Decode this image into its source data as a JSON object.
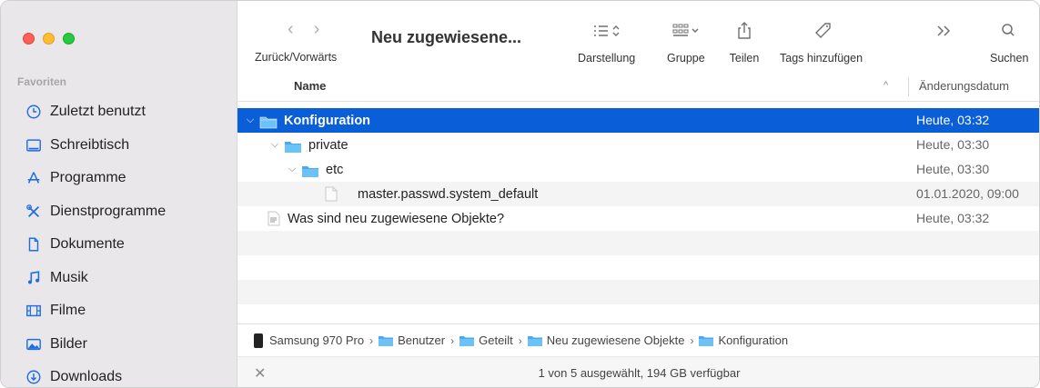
{
  "window": {
    "title": "Neu zugewiesene...",
    "colors": {
      "accent": "#0a5fd8",
      "sidebar_bg": "#e9e7ea",
      "icon_blue": "#1f6fe2"
    }
  },
  "toolbar": {
    "nav_label": "Zurück/Vorwärts",
    "back_icon": "chevron-left-icon",
    "forward_icon": "chevron-right-icon",
    "buttons": [
      {
        "label": "Darstellung",
        "icon": "list-view-icon"
      },
      {
        "label": "Gruppe",
        "icon": "group-grid-icon"
      },
      {
        "label": "Teilen",
        "icon": "share-icon"
      },
      {
        "label": "Tags hinzufügen",
        "icon": "tag-icon"
      },
      {
        "label": "",
        "icon": "overflow-chevrons-icon"
      },
      {
        "label": "Suchen",
        "icon": "search-icon"
      }
    ]
  },
  "sidebar": {
    "section": "Favoriten",
    "items": [
      {
        "label": "Zuletzt benutzt",
        "icon": "clock-icon"
      },
      {
        "label": "Schreibtisch",
        "icon": "desktop-icon"
      },
      {
        "label": "Programme",
        "icon": "apps-icon"
      },
      {
        "label": "Dienstprogramme",
        "icon": "tools-icon"
      },
      {
        "label": "Dokumente",
        "icon": "document-icon"
      },
      {
        "label": "Musik",
        "icon": "music-icon"
      },
      {
        "label": "Filme",
        "icon": "film-icon"
      },
      {
        "label": "Bilder",
        "icon": "photo-icon"
      },
      {
        "label": "Downloads",
        "icon": "download-icon"
      }
    ]
  },
  "columns": {
    "name": "Name",
    "date": "Änderungsdatum",
    "sort_caret": "^"
  },
  "files": [
    {
      "name": "Konfiguration",
      "date": "Heute, 03:32",
      "type": "folder",
      "depth": 0,
      "expanded": true,
      "selected": true
    },
    {
      "name": "private",
      "date": "Heute, 03:30",
      "type": "folder",
      "depth": 1,
      "expanded": true,
      "selected": false
    },
    {
      "name": "etc",
      "date": "Heute, 03:30",
      "type": "folder",
      "depth": 2,
      "expanded": true,
      "selected": false
    },
    {
      "name": "master.passwd.system_default",
      "date": "01.01.2020, 09:00",
      "type": "file",
      "depth": 3,
      "expanded": false,
      "selected": false
    },
    {
      "name": "Was sind neu zugewiesene Objekte?",
      "date": "Heute, 03:32",
      "type": "textfile",
      "depth": 0,
      "expanded": false,
      "selected": false
    }
  ],
  "pathbar": {
    "crumbs": [
      {
        "label": "Samsung 970 Pro",
        "icon": "disk-icon"
      },
      {
        "label": "Benutzer",
        "icon": "folder-icon"
      },
      {
        "label": "Geteilt",
        "icon": "folder-icon"
      },
      {
        "label": "Neu zugewiesene Objekte",
        "icon": "folder-icon"
      },
      {
        "label": "Konfiguration",
        "icon": "folder-icon"
      }
    ],
    "separator": "›"
  },
  "status": {
    "text": "1 von 5 ausgewählt, 194 GB verfügbar",
    "close_glyph": "✕"
  }
}
